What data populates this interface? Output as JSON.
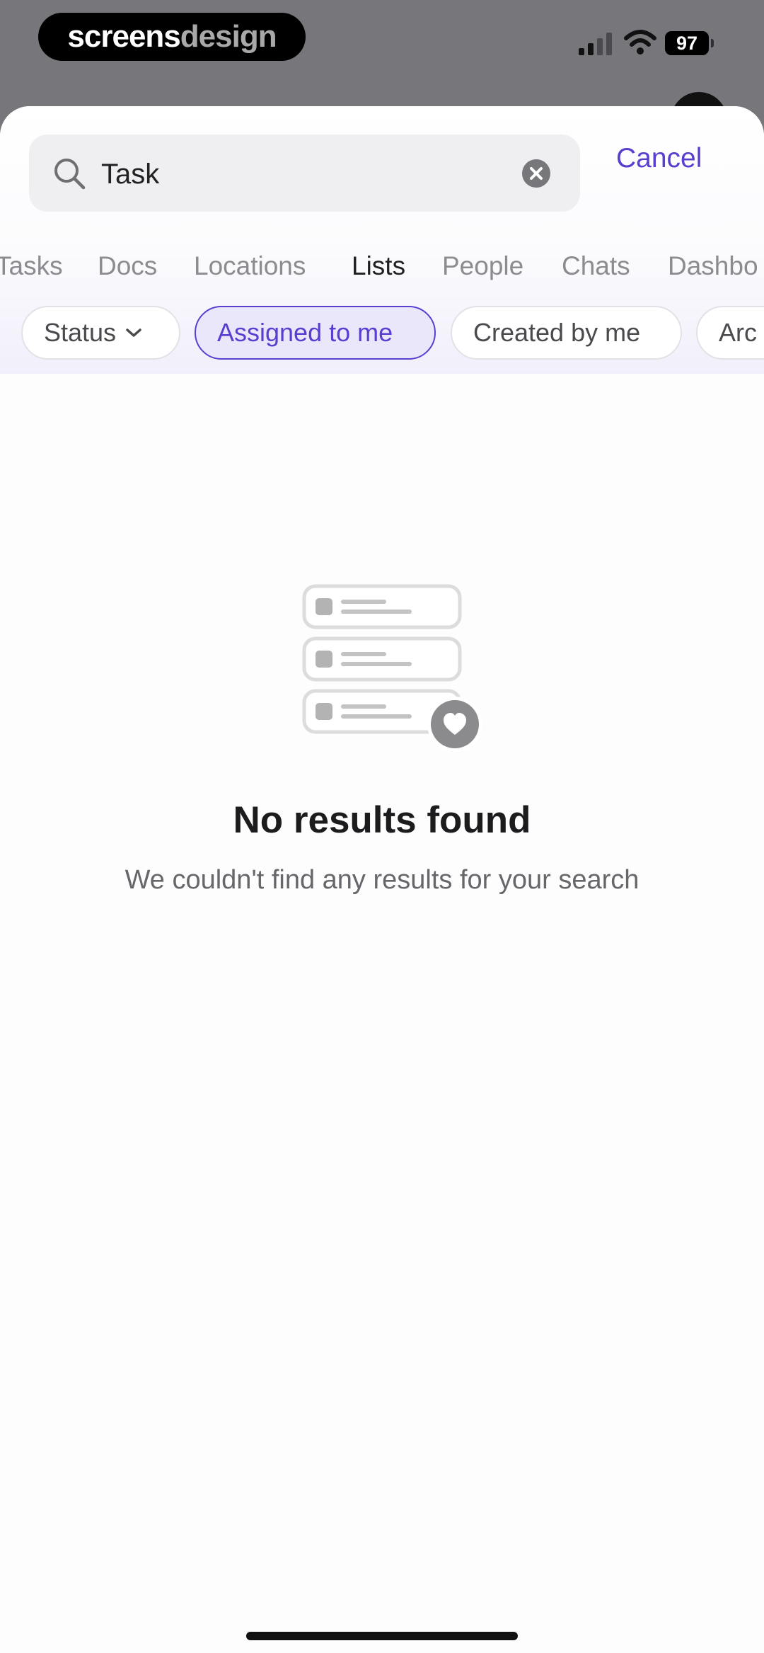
{
  "status_bar": {
    "brand_bold": "screens",
    "brand_light": "design",
    "battery": "97",
    "icons": [
      "signal-icon",
      "wifi-icon",
      "battery-icon"
    ]
  },
  "search": {
    "value": "Task",
    "placeholder": "",
    "cancel_label": "Cancel",
    "icons": [
      "search-icon",
      "clear-icon"
    ]
  },
  "tabs": [
    {
      "label": "Tasks",
      "active": false
    },
    {
      "label": "Docs",
      "active": false
    },
    {
      "label": "Locations",
      "active": false
    },
    {
      "label": "Lists",
      "active": true
    },
    {
      "label": "People",
      "active": false
    },
    {
      "label": "Chats",
      "active": false
    },
    {
      "label": "Dashbo",
      "active": false
    }
  ],
  "filters": [
    {
      "label": "Status",
      "selected": false,
      "has_dropdown": true
    },
    {
      "label": "Assigned to me",
      "selected": true,
      "has_dropdown": false
    },
    {
      "label": "Created by me",
      "selected": false,
      "has_dropdown": false
    },
    {
      "label": "Arc",
      "selected": false,
      "has_dropdown": false
    }
  ],
  "empty_state": {
    "title": "No results found",
    "subtitle": "We couldn't find any results for your search",
    "icon": "empty-list-heart-icon"
  },
  "colors": {
    "accent": "#5a3ecf",
    "accent_bg": "#ebe7fb",
    "backdrop": "#77767b"
  }
}
